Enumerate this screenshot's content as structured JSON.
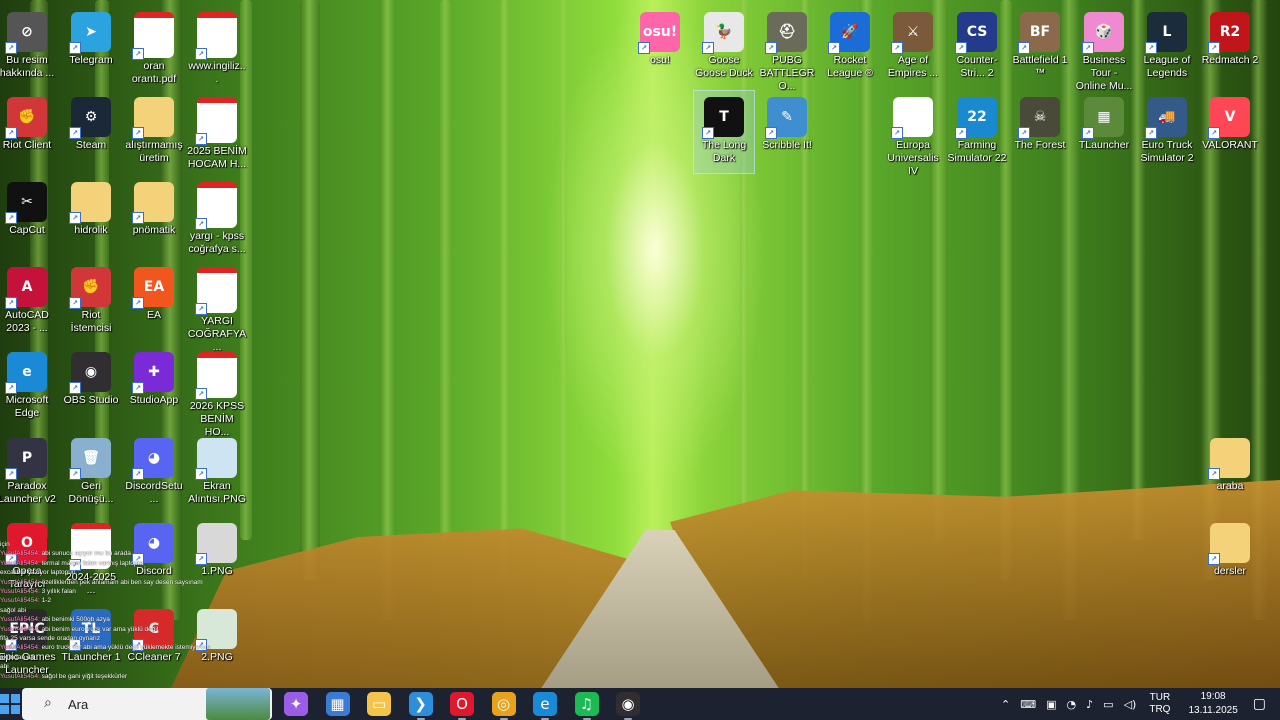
{
  "desktop": {
    "icons": [
      {
        "label": "Bu resim hakkında ...",
        "glyph": "⊘",
        "color": "#555555"
      },
      {
        "label": "Telegram",
        "glyph": "➤",
        "color": "#2aa3e0"
      },
      {
        "label": "oran orantı.pdf",
        "glyph": "PDF",
        "color": "#e02323"
      },
      {
        "label": "www.ingiliz...",
        "glyph": "PDF",
        "color": "#e02323"
      },
      {
        "label": "osu!",
        "glyph": "osu!",
        "color": "#ff66aa"
      },
      {
        "label": "Goose Goose Duck",
        "glyph": "🦆",
        "color": "#e8e8e8"
      },
      {
        "label": "PUBG BATTLEGRO...",
        "glyph": "⛑",
        "color": "#6b6b5a"
      },
      {
        "label": "Rocket League ®",
        "glyph": "🚀",
        "color": "#1a6dd6"
      },
      {
        "label": "Age of Empires ...",
        "glyph": "⚔",
        "color": "#7a5a3a"
      },
      {
        "label": "Counter-Stri... 2",
        "glyph": "CS",
        "color": "#233b8a"
      },
      {
        "label": "Battlefield 1 ™",
        "glyph": "BF",
        "color": "#8a6a4a"
      },
      {
        "label": "Business Tour - Online Mu...",
        "glyph": "🎲",
        "color": "#f08ad0"
      },
      {
        "label": "League of Legends",
        "glyph": "L",
        "color": "#1b2c3a"
      },
      {
        "label": "Redmatch 2",
        "glyph": "R2",
        "color": "#c0161b"
      },
      {
        "label": "Riot Client",
        "glyph": "✊",
        "color": "#d13639"
      },
      {
        "label": "Steam",
        "glyph": "⚙",
        "color": "#1b2838"
      },
      {
        "label": "alıştırmamış üretim",
        "glyph": "",
        "color": "#f3d27a"
      },
      {
        "label": "2025 BENİM HOCAM H...",
        "glyph": "PDF",
        "color": "#e02323"
      },
      {
        "label": "The Long Dark",
        "glyph": "T",
        "color": "#111111"
      },
      {
        "label": "Scribble It!",
        "glyph": "✎",
        "color": "#3f8fd0"
      },
      {
        "label": "Europa Universalis IV",
        "glyph": "",
        "color": "#ffffff"
      },
      {
        "label": "Farming Simulator 22",
        "glyph": "22",
        "color": "#1a8ad0"
      },
      {
        "label": "The Forest",
        "glyph": "☠",
        "color": "#4a4a3a"
      },
      {
        "label": "TLauncher",
        "glyph": "▦",
        "color": "#5a8a3a"
      },
      {
        "label": "Euro Truck Simulator 2",
        "glyph": "🚚",
        "color": "#345a8a"
      },
      {
        "label": "VALORANT",
        "glyph": "V",
        "color": "#ff4655"
      },
      {
        "label": "CapCut",
        "glyph": "✂",
        "color": "#111111"
      },
      {
        "label": "hidrolik",
        "glyph": "",
        "color": "#f3d27a"
      },
      {
        "label": "pnömatik",
        "glyph": "",
        "color": "#f3d27a"
      },
      {
        "label": "yargı - kpss coğrafya s...",
        "glyph": "PDF",
        "color": "#e02323"
      },
      {
        "label": "AutoCAD 2023 - ...",
        "glyph": "A",
        "color": "#c4123a"
      },
      {
        "label": "Riot İstemcisi",
        "glyph": "✊",
        "color": "#d13639"
      },
      {
        "label": "EA",
        "glyph": "EA",
        "color": "#f0561d"
      },
      {
        "label": "YARGI COĞRAFYA ...",
        "glyph": "PDF",
        "color": "#e02323"
      },
      {
        "label": "Microsoft Edge",
        "glyph": "e",
        "color": "#1b8ad6"
      },
      {
        "label": "OBS Studio",
        "glyph": "◉",
        "color": "#302e31"
      },
      {
        "label": "StudioApp",
        "glyph": "✚",
        "color": "#7a2ad6"
      },
      {
        "label": "2026 KPSS BENİM HO...",
        "glyph": "PDF",
        "color": "#e02323"
      },
      {
        "label": "Paradox Launcher v2",
        "glyph": "P",
        "color": "#333344"
      },
      {
        "label": "Geri Dönüşü...",
        "glyph": "🗑",
        "color": "#8ab0d0"
      },
      {
        "label": "DiscordSetu...",
        "glyph": "◕",
        "color": "#5865f2"
      },
      {
        "label": "Ekran Alıntısı.PNG",
        "glyph": "",
        "color": "#cfe4f2"
      },
      {
        "label": "Opera Tarayıcı",
        "glyph": "O",
        "color": "#e0182d"
      },
      {
        "label": "2024-2025 ...",
        "glyph": "PDF",
        "color": "#e02323"
      },
      {
        "label": "Discord",
        "glyph": "◕",
        "color": "#5865f2"
      },
      {
        "label": "1.PNG",
        "glyph": "",
        "color": "#d8d8d8"
      },
      {
        "label": "araba",
        "glyph": "",
        "color": "#f3d27a"
      },
      {
        "label": "Epic Games Launcher",
        "glyph": "EPIC",
        "color": "#2a2a2a"
      },
      {
        "label": "TLauncher 1",
        "glyph": "TL",
        "color": "#2a6ac0"
      },
      {
        "label": "CCleaner 7",
        "glyph": "C",
        "color": "#d62a2a"
      },
      {
        "label": "2.PNG",
        "glyph": "",
        "color": "#d8e8d8"
      },
      {
        "label": "dersler",
        "glyph": "",
        "color": "#f3d27a"
      }
    ]
  },
  "chat": [
    {
      "user": "",
      "text": "için"
    },
    {
      "user": "YusufAli5454",
      "text": "abi sunucu açıyor mu bu arada"
    },
    {
      "user": "YusufAli5454",
      "text": "termal macun falan varmış laptopta"
    },
    {
      "user": "",
      "text": "excalibur yazıyor laptopun"
    },
    {
      "user": "YusufAli5454",
      "text": "özelliklerden pek anlamam abi ben say desen saysınam"
    },
    {
      "user": "YusufAli5454",
      "text": "3 yıllık falan"
    },
    {
      "user": "YusufAli5454",
      "text": "1-2"
    },
    {
      "user": "",
      "text": "sağol abi"
    },
    {
      "user": "YusufAli5454",
      "text": "abi benimki 500gb azya"
    },
    {
      "user": "YusufAli5454",
      "text": "abi benim euro truck var ama yüklü değil"
    },
    {
      "user": "",
      "text": "fifa 25 varsa sende oradan oynarız"
    },
    {
      "user": "YusufAli5454",
      "text": "euro truck var abi ama yüklü değil yüklemekte istemiyorum"
    },
    {
      "user": "",
      "text": "akımdan da"
    },
    {
      "user": "",
      "text": "abi"
    },
    {
      "user": "YusufAli5454",
      "text": "sağol be gani yiğit teşekkürler"
    }
  ],
  "taskbar": {
    "search_placeholder": "Ara",
    "apps": [
      {
        "name": "copilot",
        "glyph": "✦",
        "color": "#9b5de5"
      },
      {
        "name": "store",
        "glyph": "▦",
        "color": "#3a7bd5"
      },
      {
        "name": "explorer",
        "glyph": "▭",
        "color": "#f3c34a"
      },
      {
        "name": "vscode",
        "glyph": "❯",
        "color": "#2d8fdb"
      },
      {
        "name": "opera",
        "glyph": "O",
        "color": "#e0182d"
      },
      {
        "name": "chrome",
        "glyph": "◎",
        "color": "#e8a11a"
      },
      {
        "name": "edge",
        "glyph": "e",
        "color": "#1b8ad6"
      },
      {
        "name": "spotify",
        "glyph": "♫",
        "color": "#1db954"
      },
      {
        "name": "obs",
        "glyph": "◉",
        "color": "#302e31"
      }
    ],
    "lang_top": "TUR",
    "lang_bottom": "TRQ",
    "time": "19:08",
    "date": "13.11.2025"
  }
}
